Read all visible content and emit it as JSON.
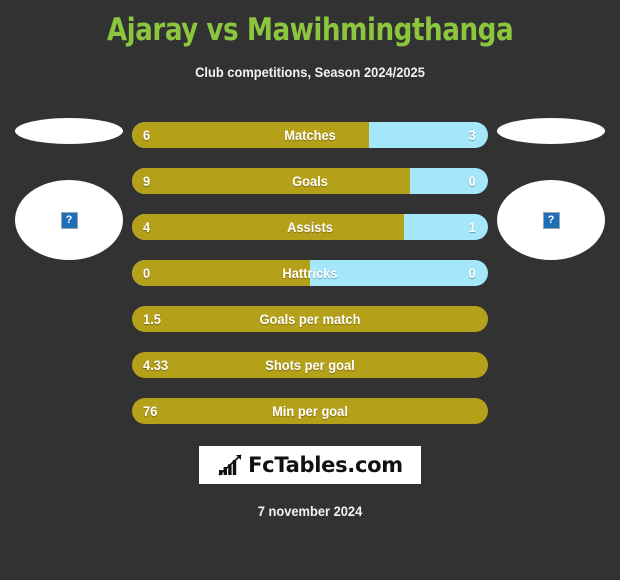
{
  "header": {
    "title": "Ajaray vs Mawihmingthanga",
    "subtitle": "Club competitions, Season 2024/2025",
    "title_color": "#8cc63e"
  },
  "colors": {
    "background": "#323232",
    "home_bar": "#b5a019",
    "away_bar": "#a5e7fa",
    "text": "#ffffff"
  },
  "players": {
    "home": {
      "flag": "flag-placeholder",
      "photo": "broken-image-placeholder",
      "photo_glyph": "?"
    },
    "away": {
      "flag": "flag-placeholder",
      "photo": "broken-image-placeholder",
      "photo_glyph": "?"
    }
  },
  "chart_data": {
    "type": "bar",
    "title": "Ajaray vs Mawihmingthanga",
    "subtitle": "Club competitions, Season 2024/2025",
    "orientation": "horizontal-diverging",
    "series": [
      {
        "name": "Ajaray",
        "color": "#b5a019"
      },
      {
        "name": "Mawihmingthanga",
        "color": "#a5e7fa"
      }
    ],
    "categories": [
      "Matches",
      "Goals",
      "Assists",
      "Hattricks",
      "Goals per match",
      "Shots per goal",
      "Min per goal"
    ],
    "rows": [
      {
        "label": "Matches",
        "home": "6",
        "away": "3",
        "home_pct": 66.7,
        "compare": true
      },
      {
        "label": "Goals",
        "home": "9",
        "away": "0",
        "home_pct": 78.0,
        "compare": true
      },
      {
        "label": "Assists",
        "home": "4",
        "away": "1",
        "home_pct": 76.5,
        "compare": true
      },
      {
        "label": "Hattricks",
        "home": "0",
        "away": "0",
        "home_pct": 50.0,
        "compare": true
      },
      {
        "label": "Goals per match",
        "home": "1.5",
        "away": "",
        "home_pct": 100,
        "compare": false
      },
      {
        "label": "Shots per goal",
        "home": "4.33",
        "away": "",
        "home_pct": 100,
        "compare": false
      },
      {
        "label": "Min per goal",
        "home": "76",
        "away": "",
        "home_pct": 100,
        "compare": false
      }
    ]
  },
  "logo": {
    "text": "FcTables.com",
    "icon": "bar-chart-trend-icon"
  },
  "footer": {
    "date": "7 november 2024"
  }
}
